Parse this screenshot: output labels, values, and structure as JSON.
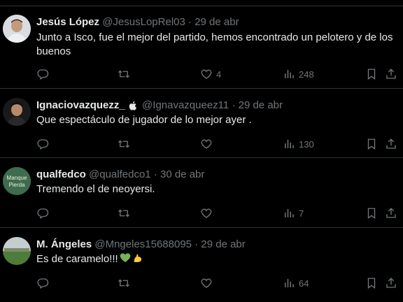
{
  "tweets": [
    {
      "name": "Jesús López",
      "handle": "@JesusLopRel03",
      "dot": "·",
      "date": "29 de abr",
      "text": "Junto a Isco, fue el mejor del partido, hemos encontrado un pelotero y de los buenos",
      "likes": "4",
      "views": "248"
    },
    {
      "name": "Ignaciovazquezz_",
      "handle": "@Ignavazqueez11",
      "dot": "·",
      "date": "29 de abr",
      "text": "Que espectáculo de jugador de lo mejor ayer .",
      "likes": "",
      "views": "130"
    },
    {
      "name": "qualfedco",
      "handle": "@qualfedco1",
      "dot": "·",
      "date": "30 de abr",
      "text": "Tremendo el de neoyersi.",
      "likes": "",
      "views": "7",
      "avatar_text": "Manque Pierda"
    },
    {
      "name": "M. Ángeles",
      "handle": "@Mngeles15688095",
      "dot": "·",
      "date": "29 de abr",
      "text": "Es de caramelo!!!",
      "likes": "",
      "views": "64"
    }
  ],
  "icons": {
    "reply": "reply-icon",
    "retweet": "retweet-icon",
    "like": "heart-icon",
    "views": "views-icon",
    "bookmark": "bookmark-icon",
    "share": "share-icon"
  },
  "colors": {
    "background": "#000000",
    "text": "#e7e9ea",
    "secondary": "#71767b",
    "divider": "#2f3336",
    "green_heart": "#78b159",
    "flexed_biceps": "#ffc83d"
  }
}
